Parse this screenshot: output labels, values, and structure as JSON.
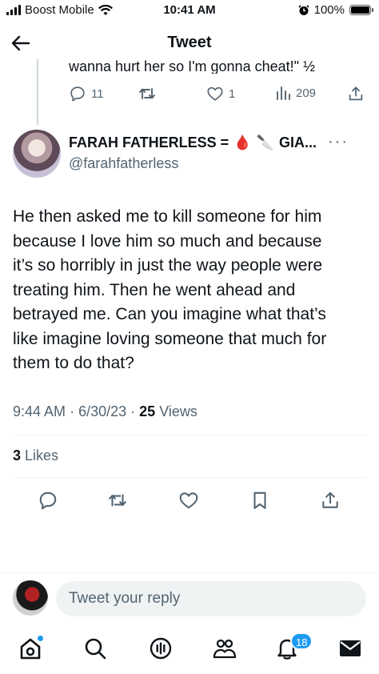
{
  "status_bar": {
    "carrier": "Boost Mobile",
    "time": "10:41 AM",
    "battery": "100%",
    "battery_level": 1.0,
    "icons": [
      "signal-icon",
      "wifi-icon",
      "alarm-icon",
      "battery-icon"
    ]
  },
  "header": {
    "title": "Tweet",
    "back_icon": "back-arrow-icon"
  },
  "parent_tweet": {
    "text": "wanna hurt her so I'm gonna cheat!\" ½",
    "replies": "11",
    "retweets": "",
    "likes": "1",
    "views": "209"
  },
  "tweet": {
    "display_name": "FARAH FATHERLESS = ",
    "display_name_suffix": "GIA...",
    "emoji": [
      "🩸",
      "🔪"
    ],
    "username": "@farahfatherless",
    "body_lines": [
      "He then asked me to kill someone for him",
      "because I love him so much and because",
      "it’s so horribly in just the way people were",
      "treating him. Then he went ahead and",
      "betrayed me. Can you imagine what that’s",
      "like imagine loving someone that much for",
      "them to do that?"
    ],
    "time": "9:44 AM",
    "date": "6/30/23",
    "separator": "·",
    "views_count": "25",
    "views_label": "Views",
    "likes_count": "3",
    "likes_label": "Likes",
    "more": "···"
  },
  "reply": {
    "placeholder": "Tweet your reply"
  },
  "tab_bar": {
    "tabs": [
      "home-icon",
      "search-icon",
      "spaces-icon",
      "communities-icon",
      "notifications-icon",
      "messages-icon"
    ],
    "notification_count": "18"
  },
  "colors": {
    "accent": "#1d9bf0",
    "text": "#0f1419",
    "secondary": "#536471",
    "divider": "#eff3f4"
  }
}
